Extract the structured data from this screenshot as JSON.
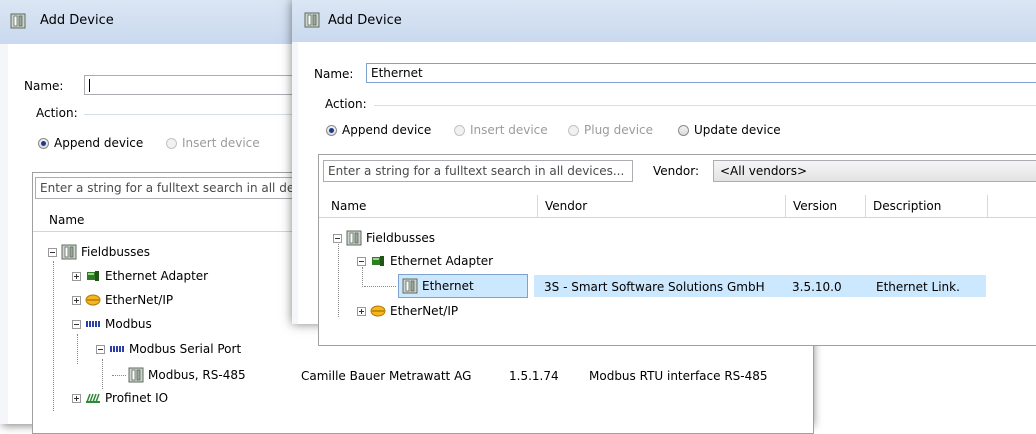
{
  "back": {
    "title": "Add Device",
    "name_label": "Name:",
    "name_value": "",
    "action_label": "Action:",
    "actions": [
      "Append device",
      "Insert device"
    ],
    "search_placeholder": "Enter a string for a fulltext search in all de",
    "col_name": "Name",
    "tree": {
      "fieldbusses": "Fieldbusses",
      "ethernet_adapter": "Ethernet Adapter",
      "ethernetip": "EtherNet/IP",
      "modbus": "Modbus",
      "modbus_serial_port": "Modbus Serial Port",
      "modbus_rs485": "Modbus, RS-485",
      "profinet": "Profinet IO"
    },
    "row": {
      "vendor": "Camille Bauer Metrawatt AG",
      "version": "1.5.1.74",
      "description": "Modbus RTU interface RS-485"
    }
  },
  "front": {
    "title": "Add Device",
    "name_label": "Name:",
    "name_value": "Ethernet",
    "action_label": "Action:",
    "actions": [
      "Append device",
      "Insert device",
      "Plug device",
      "Update device"
    ],
    "search_placeholder": "Enter a string for a fulltext search in all devices...",
    "vendor_label": "Vendor:",
    "vendor_value": "<All vendors>",
    "columns": [
      "Name",
      "Vendor",
      "Version",
      "Description"
    ],
    "tree": {
      "fieldbusses": "Fieldbusses",
      "ethernet_adapter": "Ethernet Adapter",
      "ethernet": "Ethernet",
      "ethernetip": "EtherNet/IP"
    },
    "row": {
      "vendor": "3S - Smart Software Solutions GmbH",
      "version": "3.5.10.0",
      "description": "Ethernet Link."
    }
  },
  "colors": {
    "title_bar": "#c9d9ee",
    "selection": "#cce8ff"
  }
}
